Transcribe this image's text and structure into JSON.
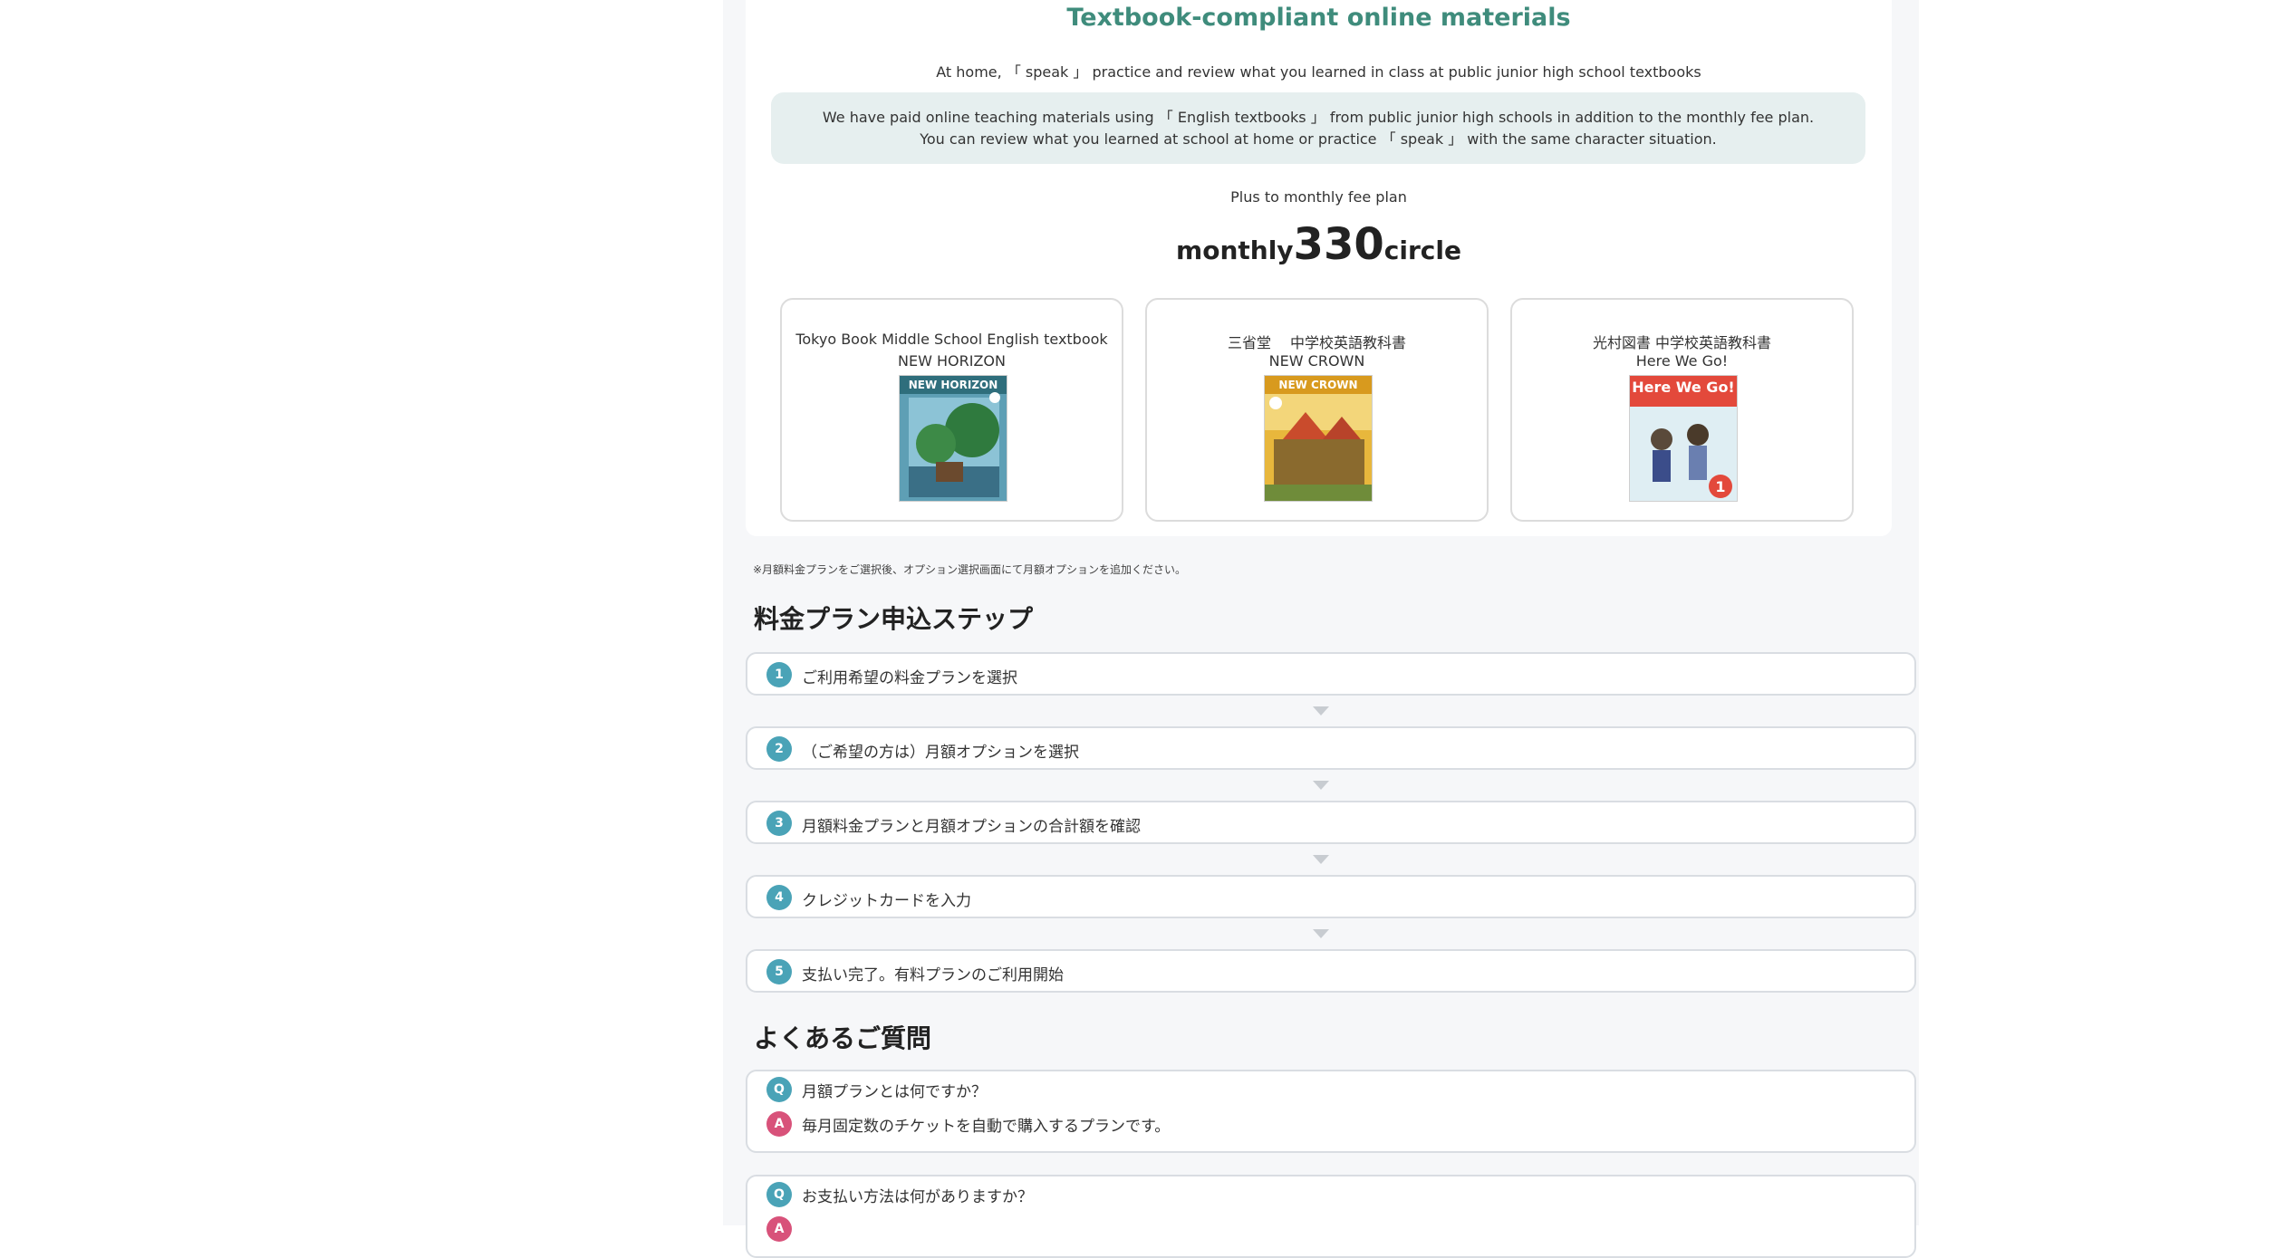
{
  "textbook_section": {
    "title": "Textbook-compliant online materials",
    "intro": "At home, 「 speak 」 practice and review what you learned in class at public junior high school textbooks",
    "notice_line1": "We have paid online teaching materials using 「 English textbooks 」 from public junior high schools in addition to the monthly fee plan.",
    "notice_line2": "You can review what you learned at school at home or practice 「 speak 」 with the same character situation.",
    "plus_label": "Plus to monthly fee plan",
    "price_prefix": "monthly",
    "price_value": "330",
    "price_suffix": "circle",
    "books": [
      {
        "line1": "Tokyo Book Middle School English textbook",
        "line2": "NEW HORIZON",
        "cover_title": "NEW HORIZON"
      },
      {
        "line1": "三省堂　 中学校英語教科書",
        "line2": "NEW CROWN",
        "cover_title": "NEW CROWN"
      },
      {
        "line1": "光村図書 中学校英語教科書",
        "line2": "Here We Go!",
        "cover_title": "Here We Go!"
      }
    ]
  },
  "option_note": "※月額料金プランをご選択後、オプション選択画面にて月額オプションを追加ください。",
  "steps_section": {
    "heading": "料金プラン申込ステップ",
    "steps": [
      {
        "num": "1",
        "label": "ご利用希望の料金プランを選択"
      },
      {
        "num": "2",
        "label": "（ご希望の方は）月額オプションを選択"
      },
      {
        "num": "3",
        "label": "月額料金プランと月額オプションの合計額を確認"
      },
      {
        "num": "4",
        "label": "クレジットカードを入力"
      },
      {
        "num": "5",
        "label": "支払い完了。有料プランのご利用開始"
      }
    ]
  },
  "faq_section": {
    "heading": "よくあるご質問",
    "q_mark": "Q",
    "a_mark": "A",
    "items": [
      {
        "q": "月額プランとは何ですか？",
        "a": "毎月固定数のチケットを自動で購入するプランです。"
      },
      {
        "q": "お支払い方法は何がありますか？",
        "a": ""
      }
    ]
  },
  "colors": {
    "title_green": "#3f8c7c",
    "badge_blue": "#4aa3b7",
    "badge_pink": "#d8527a",
    "notice_bg": "#e6efef"
  }
}
